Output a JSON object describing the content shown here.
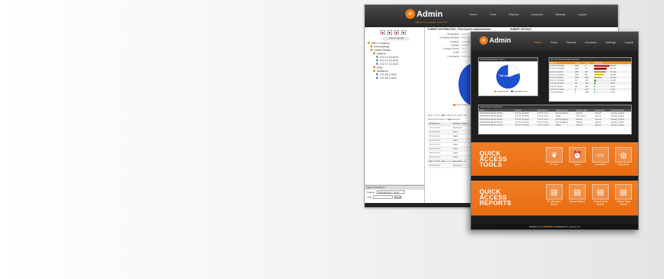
{
  "back_window": {
    "brand": {
      "mark": "ip",
      "name": "Admin",
      "tagline": "ADMIN 2.0 | Licensed: Version 2.0"
    },
    "nav": [
      "Home",
      "Tools",
      "Reports",
      "Accounts",
      "Settings",
      "Logout"
    ],
    "toolbar_icons": [
      "add-icon",
      "delete-icon",
      "move-icon",
      "link-icon"
    ],
    "tree_selected": "172.17.12.0/4",
    "tree": [
      {
        "label": "ABC Company",
        "type": "folder",
        "level": 0
      },
      {
        "label": "International",
        "type": "folder",
        "level": 1
      },
      {
        "label": "United States",
        "type": "folder",
        "level": 1
      },
      {
        "label": "Default",
        "type": "folder",
        "level": 2
      },
      {
        "label": "172.17.10.0/24",
        "type": "ip",
        "level": 3
      },
      {
        "label": "172.17.12.0/24",
        "type": "ip",
        "level": 3
      },
      {
        "label": "172.17.12.0/24",
        "type": "ip",
        "level": 3
      },
      {
        "label": "(HA)",
        "type": "folder",
        "level": 2
      },
      {
        "label": "Alabama",
        "type": "folder",
        "level": 2
      },
      {
        "label": "172.16.1.0/24",
        "type": "ip",
        "level": 3
      },
      {
        "label": "172.26.2.0/24",
        "type": "ip",
        "level": 3
      }
    ],
    "quick_search": {
      "title": "QUICK SEARCH",
      "label1": "Search:",
      "value1": "Subnet/Group – Name",
      "label2": "Text:",
      "button": "Submit"
    },
    "subnet_info_title": "SUBNET INFORMATION - Field System Administration",
    "subnet_details_title": "SUBNET DETAILS",
    "info_rows": [
      {
        "key": "Description",
        "value": "First Floor"
      },
      {
        "key": "Company Division",
        "value": "ABC Co"
      },
      {
        "key": "Location",
        "value": "Colorado"
      },
      {
        "key": "Contact",
        "value": "Admin"
      },
      {
        "key": "Contact Phone",
        "value": "303-..."
      },
      {
        "key": "VLAN",
        "value": "100"
      },
      {
        "key": "Comments",
        "value": "Data use"
      }
    ],
    "pie_label": "100.00%",
    "pie_legend": "Total Assigned IPs",
    "pager_top": "Page 1 of 24  |  ◀ ▶  Total Count: 2041 Last",
    "filter_text": "Show Filed Option: 8  ◀ ▶ Records",
    "ip_table": {
      "headers": [
        "IP Address",
        "Address Type"
      ],
      "rows": [
        [
          "172.17.12.0",
          "Reserved"
        ],
        [
          "172.17.12.1",
          "Static"
        ],
        [
          "172.17.12.2",
          "Static"
        ],
        [
          "172.17.12.3",
          "Static"
        ],
        [
          "172.17.12.4",
          "Static"
        ],
        [
          "172.17.12.5",
          "Static"
        ],
        [
          "172.17.12.6",
          "Static"
        ],
        [
          "172.17.12.7",
          "Static"
        ],
        [
          "172.17.12.8",
          "Reserved"
        ],
        [
          "172.17.12.9",
          "Reserved"
        ]
      ]
    },
    "pager_bottom": "Page 1 of 24  |  ◀ ▶  Total Count: 2041 Last"
  },
  "front_window": {
    "brand": {
      "mark": "ip",
      "name": "Admin"
    },
    "nav": [
      "Home",
      "Tools",
      "Reports",
      "Accounts",
      "Settings",
      "Logout"
    ],
    "pie_panel": {
      "title": "Total IPv4 Allocation Top 5",
      "center_label": "PIE CHART",
      "legend": [
        "Assigned IPs",
        "Unassigned IPs"
      ]
    },
    "subnets_panel": {
      "title": "Top 10 IPv4 Allocated Subnets",
      "headers": [
        "Subnet",
        "Used",
        "Free",
        "Utilization"
      ],
      "rows": [
        {
          "subnet": "172.17.10.0/24",
          "used": "251",
          "free": "3",
          "pct": 99.8
        },
        {
          "subnet": "172.17.12.0/24",
          "used": "208",
          "free": "45",
          "pct": 82.2
        },
        {
          "subnet": "172.17.3.0/24",
          "used": "188",
          "free": "65",
          "pct": 74.3
        },
        {
          "subnet": "172.17.20.0/24",
          "used": "164",
          "free": "89",
          "pct": 64.8
        },
        {
          "subnet": "172.17.4.0/24",
          "used": "108",
          "free": "145",
          "pct": 42.7
        },
        {
          "subnet": "172.17.30.0/24",
          "used": "36",
          "free": "217",
          "pct": 14.2
        },
        {
          "subnet": "172.16.22.0/24",
          "used": "16",
          "free": "237",
          "pct": 6.3
        },
        {
          "subnet": "172.17.4.0/24",
          "used": "12",
          "free": "241",
          "pct": 4.7
        },
        {
          "subnet": "172.17.11.0/24",
          "used": "6",
          "free": "247",
          "pct": 2.4
        },
        {
          "subnet": "172.16.8.0/24",
          "used": "4",
          "free": "249",
          "pct": 1.6
        }
      ],
      "bar_colors": [
        "#c0392b",
        "#8e1b1b",
        "#e67e22",
        "#e6c200",
        "#a6c41a",
        "#4caf50",
        "#4caf50",
        "#4caf50",
        "#4caf50",
        "#4caf50"
      ]
    },
    "audit_panel": {
      "title": "Last 5 Audit Log Events",
      "headers": [
        "Time",
        "Subnet",
        "IP Address",
        "Address Type",
        "Device Type",
        "Hostname",
        "Device Polled"
      ],
      "rows": [
        [
          "07/31/2013 09:45:44 AM",
          "172.17.12.0/24",
          "172.17.12.1",
          "Not Assigned",
          "Printer",
          "Host-5",
          "device_polled"
        ],
        [
          "07/31/2013 09:44:46 AM",
          "172.17.12.0/24",
          "172.17.12.2",
          "Static",
          "PC/Laptop",
          "Host-4",
          "device_polled"
        ],
        [
          "07/31/2013 09:44:18 AM",
          "172.17.12.0/24",
          "172.17.12.3",
          "Not Assigned",
          "Server",
          "Host-3",
          "device_polled"
        ],
        [
          "07/31/2013 09:43:50 AM",
          "172.17.12.0/24",
          "172.17.12.4",
          "Not Assigned",
          "Switch",
          "Host-2",
          "device_polled"
        ],
        [
          "07/31/2013 09:43:22 AM",
          "172.17.12.0/24",
          "172.17.12.5",
          "Static",
          "Router",
          "Host-1",
          "device_polled"
        ]
      ]
    },
    "tools_band": {
      "title": [
        "QUICK",
        "ACCESS",
        "TOOLS"
      ],
      "items": [
        {
          "label": "IP Tree",
          "icon": "leaf-icon",
          "glyph": "❦"
        },
        {
          "label": "Alarm",
          "icon": "alarm-clock-icon",
          "glyph": "⏰"
        },
        {
          "label": "Twine8004",
          "icon": "laptop-icon",
          "glyph": "▭"
        },
        {
          "label": "Ping Scan",
          "icon": "globe-icon",
          "glyph": "◍"
        }
      ]
    },
    "reports_band": {
      "title": [
        "QUICK",
        "ACCESS",
        "REPORTS"
      ],
      "items": [
        {
          "label": "IP Allocation Report",
          "icon": "report-icon",
          "glyph": "▤"
        },
        {
          "label": "Subnet Report",
          "icon": "report-icon",
          "glyph": "▤"
        },
        {
          "label": "Subnet Audit Report",
          "icon": "report-icon",
          "glyph": "▤"
        },
        {
          "label": "Device Type Report",
          "icon": "report-icon",
          "glyph": "▤"
        }
      ]
    },
    "footer": {
      "prefix": "IPADMIN v2.0 | ",
      "brand": "IPADMIN",
      "suffix": " | POWERED BY ipAdmin 2.0"
    }
  },
  "colors": {
    "accent": "#f7941d",
    "band": "#ee7422",
    "header": "#2e2e2e",
    "pie_blue": "#1f4fd1"
  }
}
